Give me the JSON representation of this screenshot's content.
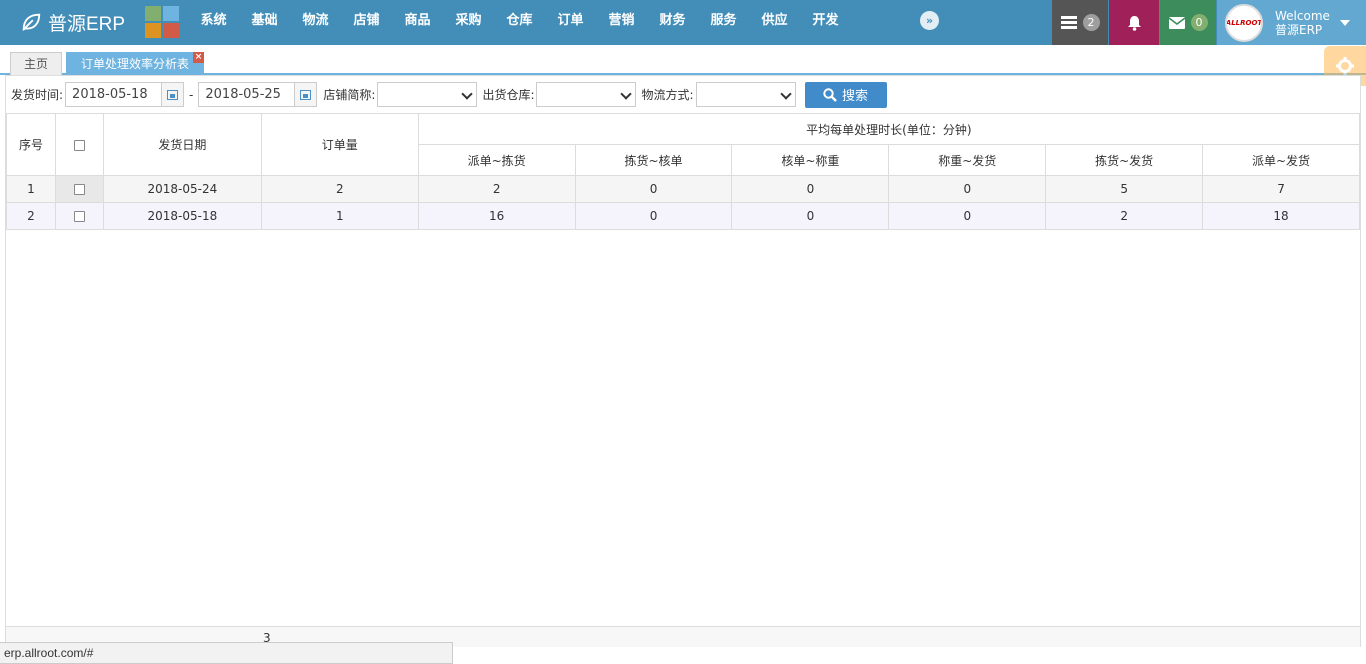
{
  "app": {
    "brand": "普源ERP"
  },
  "nav": [
    "系统",
    "基础",
    "物流",
    "店铺",
    "商品",
    "采购",
    "仓库",
    "订单",
    "营销",
    "财务",
    "服务",
    "供应",
    "开发"
  ],
  "header": {
    "tasks_count": "2",
    "mail_count": "0",
    "welcome": "Welcome",
    "user_name": "普源ERP",
    "avatar_text": "ALLROOT"
  },
  "tabs": {
    "home": "主页",
    "active": "订单处理效率分析表"
  },
  "filters": {
    "ship_time_label": "发货时间:",
    "date_from": "2018-05-18",
    "date_sep": "-",
    "date_to": "2018-05-25",
    "shop_label": "店铺简称:",
    "warehouse_label": "出货仓库:",
    "logistics_label": "物流方式:",
    "search_label": "搜索"
  },
  "table": {
    "headers": {
      "index": "序号",
      "ship_date": "发货日期",
      "order_count": "订单量",
      "group": "平均每单处理时长(单位：分钟)",
      "sub": [
        "派单~拣货",
        "拣货~核单",
        "核单~称重",
        "称重~发货",
        "拣货~发货",
        "派单~发货"
      ]
    },
    "rows": [
      {
        "index": "1",
        "date": "2018-05-24",
        "orders": "2",
        "v": [
          "2",
          "0",
          "0",
          "0",
          "5",
          "7"
        ]
      },
      {
        "index": "2",
        "date": "2018-05-18",
        "orders": "1",
        "v": [
          "16",
          "0",
          "0",
          "0",
          "2",
          "18"
        ]
      }
    ],
    "footer_total": "3"
  },
  "status_url": "erp.allroot.com/#",
  "colors": {
    "header": "#438eb9",
    "tab_active": "#6fb3e0",
    "search_button": "#428bca"
  }
}
